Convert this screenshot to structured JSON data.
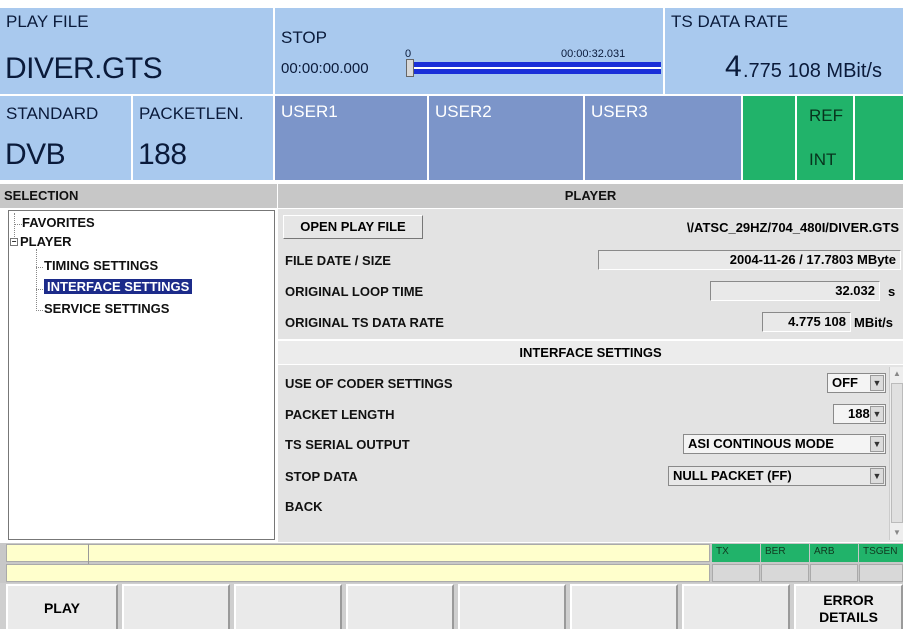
{
  "header": {
    "play_file_label": "PLAY FILE",
    "play_file_value": "DIVER.GTS",
    "transport_label": "STOP",
    "time_current": "00:00:00.000",
    "time_total": "00:00:32.031",
    "slider_start_marker": "0",
    "slider_position": 0,
    "ts_rate_label": "TS DATA RATE",
    "ts_rate_value_big": "4",
    "ts_rate_value_rest": ".775 108 MBit/s",
    "standard_label": "STANDARD",
    "standard_value": "DVB",
    "packetlen_label": "PACKETLEN.",
    "packetlen_value": "188",
    "user1": "USER1",
    "user2": "USER2",
    "user3": "USER3",
    "ref_label": "REF",
    "ref_value": "INT"
  },
  "selection": {
    "title": "SELECTION",
    "items": [
      {
        "label": "FAVORITES"
      },
      {
        "label": "PLAYER"
      },
      {
        "label": "TIMING SETTINGS"
      },
      {
        "label": "INTERFACE SETTINGS"
      },
      {
        "label": "SERVICE SETTINGS"
      }
    ]
  },
  "player": {
    "title": "PLAYER",
    "open_button": "OPEN PLAY FILE",
    "file_path": "\\/ATSC_29HZ/704_480I/DIVER.GTS",
    "file_date_label": "FILE DATE / SIZE",
    "file_date_value": "2004-11-26  /  17.7803 MByte",
    "loop_time_label": "ORIGINAL LOOP TIME",
    "loop_time_value": "32.032",
    "loop_time_unit": "s",
    "ts_rate_label": "ORIGINAL TS DATA RATE",
    "ts_rate_value": "4.775 108",
    "ts_rate_unit": "MBit/s"
  },
  "interface": {
    "title": "INTERFACE SETTINGS",
    "coder_label": "USE OF CODER SETTINGS",
    "coder_value": "OFF",
    "packet_length_label": "PACKET LENGTH",
    "packet_length_value": "188",
    "serial_output_label": "TS SERIAL OUTPUT",
    "serial_output_value": "ASI CONTINOUS MODE",
    "stop_data_label": "STOP DATA",
    "stop_data_value": "NULL PACKET (FF)",
    "back_label": "BACK"
  },
  "status": {
    "tx": "TX",
    "ber": "BER",
    "arb": "ARB",
    "tsgen": "TSGEN"
  },
  "softkeys": {
    "key1": "PLAY",
    "key8_line1": "ERROR",
    "key8_line2": "DETAILS"
  },
  "colors": {
    "header_bg": "#a9c9ee",
    "user_bg": "#7c95c9",
    "green": "#21b36a",
    "selection": "#1c2b8a",
    "slider_blue": "#1a2fd8",
    "status_yellow": "#ffffcc"
  }
}
